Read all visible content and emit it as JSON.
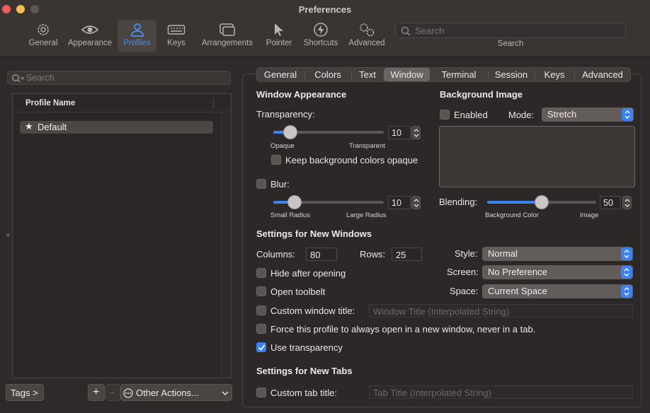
{
  "window": {
    "title": "Preferences"
  },
  "toolbar": {
    "items": [
      {
        "label": "General",
        "icon": "gear-icon"
      },
      {
        "label": "Appearance",
        "icon": "eye-icon"
      },
      {
        "label": "Profiles",
        "icon": "person-icon"
      },
      {
        "label": "Keys",
        "icon": "keyboard-icon"
      },
      {
        "label": "Arrangements",
        "icon": "windows-icon"
      },
      {
        "label": "Pointer",
        "icon": "pointer-icon"
      },
      {
        "label": "Shortcuts",
        "icon": "bolt-icon"
      },
      {
        "label": "Advanced",
        "icon": "gears-icon"
      }
    ],
    "selected": "Profiles",
    "search_placeholder": "Search",
    "search_label": "Search"
  },
  "profiles": {
    "search_placeholder": "Search",
    "column_header": "Profile Name",
    "items": [
      {
        "name": "Default",
        "starred": true
      }
    ],
    "tags_button": "Tags >",
    "add_button": "+",
    "remove_button": "–",
    "other_actions": "Other Actions..."
  },
  "tabs": {
    "items": [
      "General",
      "Colors",
      "Text",
      "Window",
      "Terminal",
      "Session",
      "Keys",
      "Advanced"
    ],
    "active": "Window"
  },
  "window_appearance": {
    "heading": "Window Appearance",
    "transparency_label": "Transparency:",
    "transparency_value": "10",
    "transparency_level": 0.1,
    "opaque_label": "Opaque",
    "transparent_label": "Transparent",
    "keep_opaque_label": "Keep background colors opaque",
    "keep_opaque_checked": false,
    "blur_label": "Blur:",
    "blur_checked": false,
    "blur_value": "10",
    "blur_level": 0.15,
    "small_radius_label": "Small Radius",
    "large_radius_label": "Large Radius"
  },
  "background_image": {
    "heading": "Background Image",
    "enabled_label": "Enabled",
    "enabled_checked": false,
    "mode_label": "Mode:",
    "mode_value": "Stretch",
    "blending_label": "Blending:",
    "blending_value": "50",
    "blending_level": 0.5,
    "background_color_label": "Background Color",
    "image_label": "Image"
  },
  "new_windows": {
    "heading": "Settings for New Windows",
    "columns_label": "Columns:",
    "columns_value": "80",
    "rows_label": "Rows:",
    "rows_value": "25",
    "style_label": "Style:",
    "style_value": "Normal",
    "screen_label": "Screen:",
    "screen_value": "No Preference",
    "space_label": "Space:",
    "space_value": "Current Space",
    "hide_after_opening": "Hide after opening",
    "open_toolbelt": "Open toolbelt",
    "custom_window_title": "Custom window title:",
    "window_title_placeholder": "Window Title (Interpolated String)",
    "force_new_window": "Force this profile to always open in a new window, never in a tab.",
    "use_transparency": "Use transparency",
    "use_transparency_checked": true
  },
  "new_tabs": {
    "heading": "Settings for New Tabs",
    "custom_tab_title": "Custom tab title:",
    "tab_title_placeholder": "Tab Title (Interpolated String)"
  },
  "colors": {
    "accent": "#3b82f6",
    "toolbar_selected": "#4b90f5"
  }
}
